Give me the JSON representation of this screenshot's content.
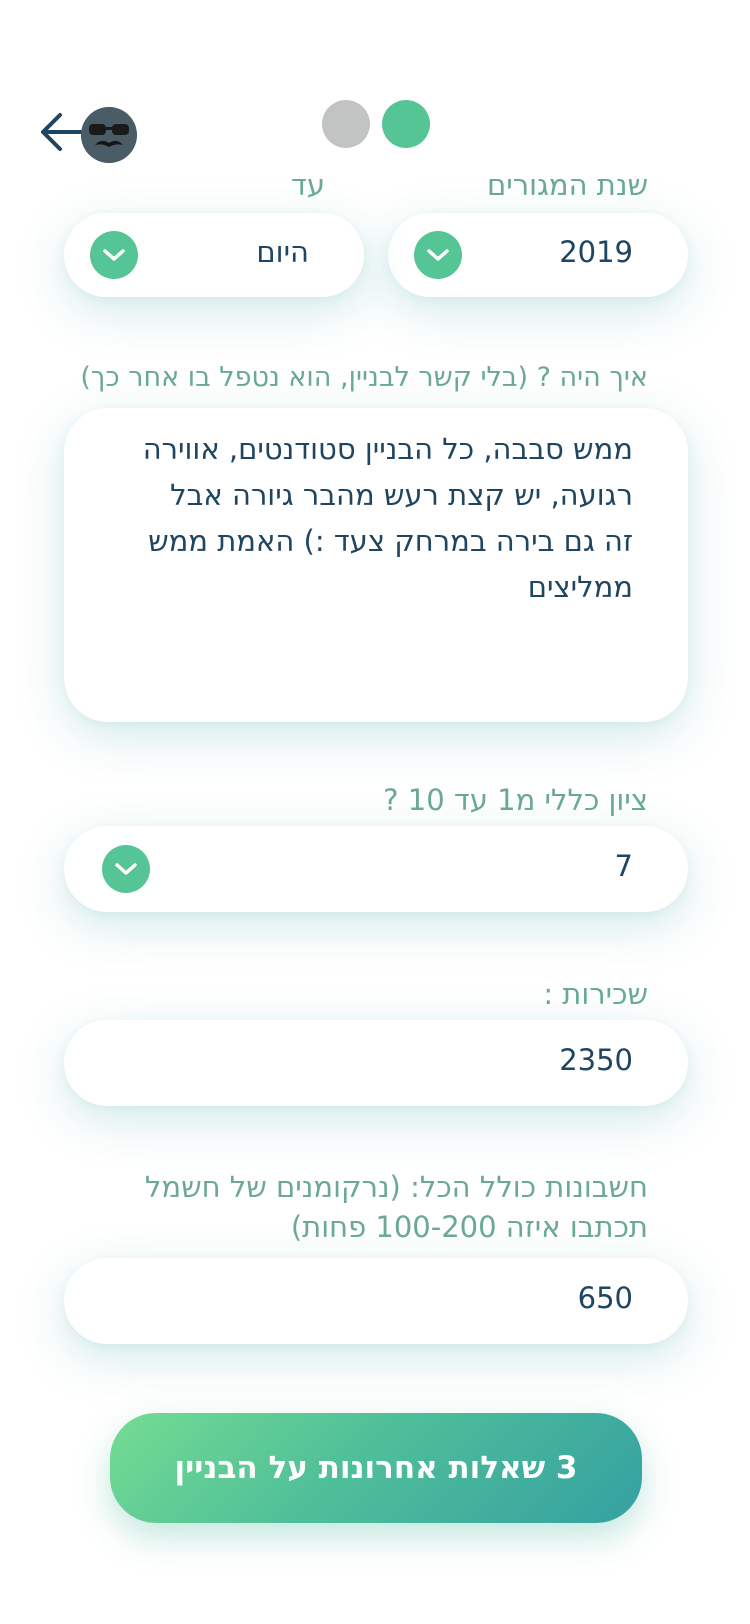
{
  "progress": {
    "steps": 2,
    "active_step": 2,
    "colors": {
      "inactive": "#c2c4c4",
      "active": "#56c596"
    }
  },
  "header": {
    "back_icon": "arrow-left-icon",
    "avatar_icon": "avatar-mustache-glasses-icon"
  },
  "residency": {
    "year_label": "שנת המגורים",
    "year_value": "2019",
    "until_label": "עד",
    "until_value": "היום"
  },
  "how_was_it": {
    "label": "איך היה ? (בלי קשר לבניין, הוא נטפל בו אחר כך)",
    "lines": [
      "ממש סבבה, כל הבניין סטודנטים, אווירה",
      "רגועה, יש קצת רעש מהבר גיורה אבל",
      "זה גם בירה במרחק צעד :) האמת ממש",
      "ממליצים"
    ]
  },
  "rating": {
    "label": "ציון כללי מ1 עד 10 ?",
    "value": "7"
  },
  "rent": {
    "label": "שכירות :",
    "value": "2350"
  },
  "bills": {
    "label_line1": "חשבונות כולל הכל: (נרקומנים של חשמל",
    "label_line2": "תכתבו איזה 100-200 פחות)",
    "value": "650"
  },
  "cta": {
    "label": "3 שאלות אחרונות על הבניין"
  },
  "colors": {
    "accent": "#56c596",
    "label": "#6aaa92",
    "text": "#1f4560"
  }
}
